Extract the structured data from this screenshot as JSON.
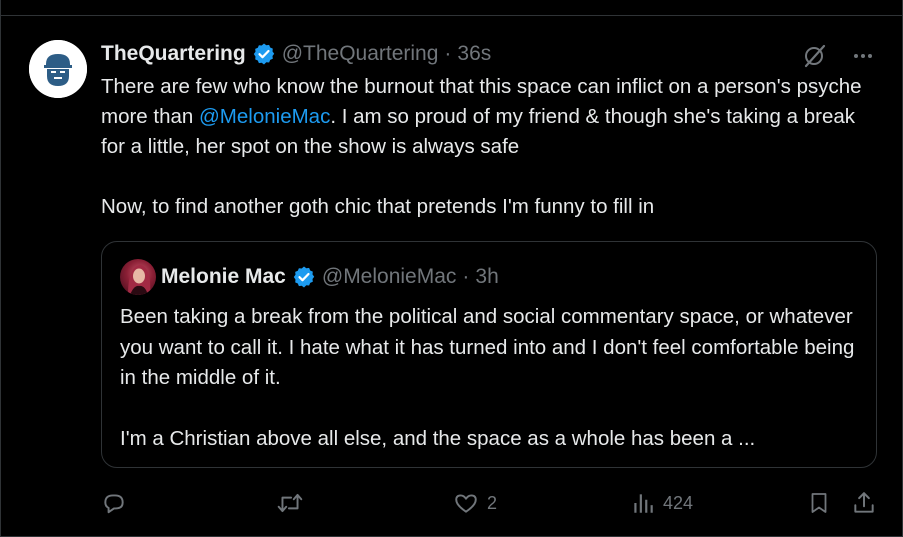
{
  "tweet": {
    "display_name": "TheQuartering",
    "handle": "@TheQuartering",
    "separator": "·",
    "time": "36s",
    "text_part1": "There are few who know the burnout that this space can inflict on a person's psyche more than ",
    "mention": "@MelonieMac",
    "text_part2": ". I am so proud of my friend & though she's taking a break for a little, her spot on the show is always safe",
    "text_para2": "Now, to find another goth chic that pretends I'm funny to fill in"
  },
  "quote": {
    "display_name": "Melonie Mac",
    "handle": "@MelonieMac",
    "separator": "·",
    "time": "3h",
    "para1": "Been taking a break from the political and social commentary space, or whatever you want to call it. I hate what it has turned into and I don't feel comfortable being in the middle of it.",
    "para2": "I'm a Christian above all else, and the space as a whole has been a ..."
  },
  "actions": {
    "reply_count": "",
    "retweet_count": "",
    "like_count": "2",
    "view_count": "424"
  },
  "colors": {
    "background": "#000000",
    "text": "#e7e9ea",
    "muted": "#71767b",
    "accent": "#1d9bf0",
    "border": "#2f3336"
  },
  "icons": [
    "grok-icon",
    "more-icon",
    "verified-icon",
    "reply-icon",
    "retweet-icon",
    "like-icon",
    "views-icon",
    "bookmark-icon",
    "share-icon"
  ]
}
